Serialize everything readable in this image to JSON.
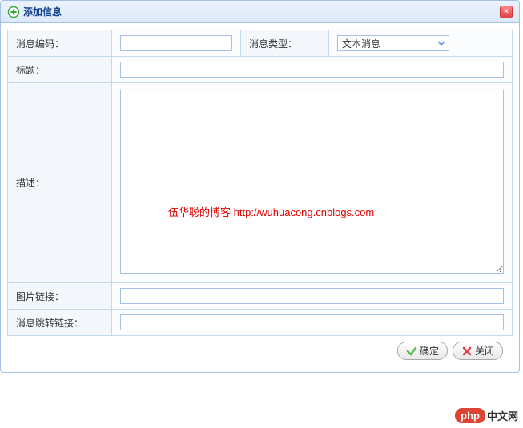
{
  "dialog": {
    "title": "添加信息",
    "close_glyph": "×"
  },
  "form": {
    "msg_code_label": "消息编码：",
    "msg_code_value": "",
    "msg_type_label": "消息类型：",
    "msg_type_value": "文本消息",
    "title_label": "标题：",
    "title_value": "",
    "desc_label": "描述：",
    "desc_value": "",
    "image_link_label": "图片链接：",
    "image_link_value": "",
    "jump_link_label": "消息跳转链接：",
    "jump_link_value": ""
  },
  "watermark": "伍华聪的博客 http://wuhuacong.cnblogs.com",
  "buttons": {
    "ok": "确定",
    "close": "关闭"
  },
  "badge": {
    "pill": "php",
    "text": "中文网"
  }
}
